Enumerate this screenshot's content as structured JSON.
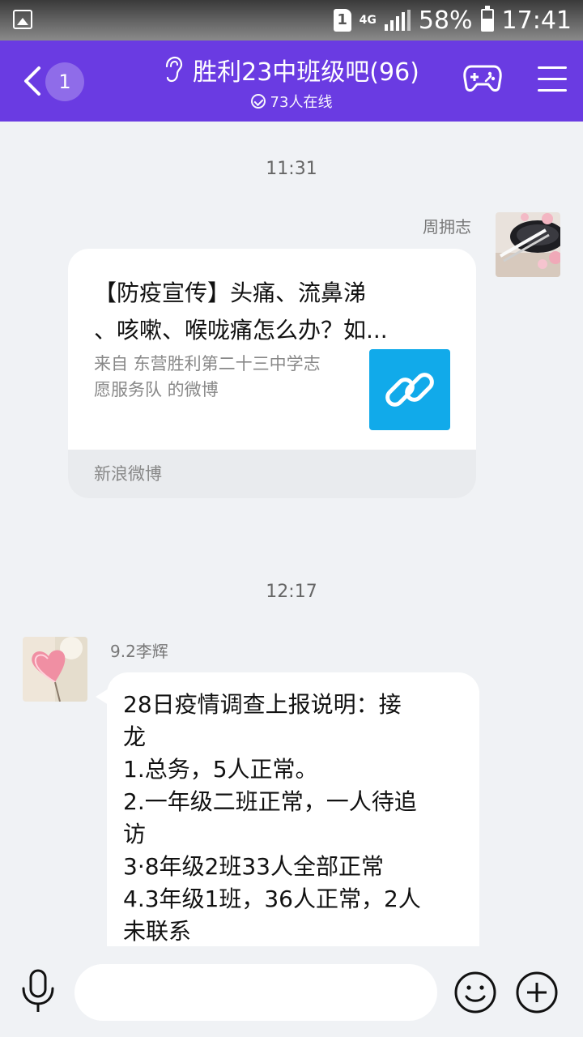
{
  "status_bar": {
    "sim": "1",
    "network": "4G",
    "battery": "58%",
    "time": "17:41"
  },
  "header": {
    "unread_count": "1",
    "title": "胜利23中班级吧(96)",
    "online": "73人在线"
  },
  "messages": [
    {
      "timestamp": "11:31",
      "sender": "周拥志",
      "card": {
        "title": "【防疫宣传】头痛、流鼻涕、咳嗽、喉咙痛怎么办？如...",
        "title_line1": "【防疫宣传】头痛、流鼻涕",
        "title_line2": "、咳嗽、喉咙痛怎么办？如...",
        "desc_line1": "来自 东营胜利第二十三中学志",
        "desc_line2": "愿服务队 的微博",
        "source": "新浪微博",
        "thumb_icon": "link-icon"
      }
    },
    {
      "timestamp": "12:17",
      "sender": "9.2李辉",
      "lines": [
        "28日疫情调查上报说明：接",
        "龙",
        "1.总务，5人正常。",
        "2.一年级二班正常，一人待追",
        "访",
        "3·8年级2班33人全部正常",
        "4.3年级1班，36人正常，2人",
        "未联系"
      ]
    }
  ],
  "input_bar": {
    "placeholder": ""
  },
  "colors": {
    "header_bg": "#6a3be2",
    "chat_bg": "#f0f2f5",
    "link_thumb": "#11aaea"
  }
}
